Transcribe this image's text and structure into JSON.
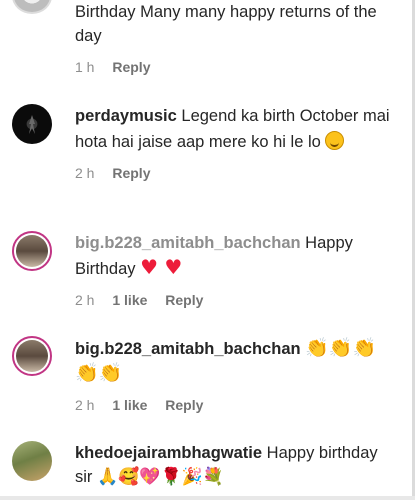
{
  "comments": [
    {
      "username": "",
      "text": "Birthday Many many happy returns of the day",
      "time": "1 h",
      "likes": "",
      "reply": "Reply",
      "avatar": "avatar-partial-icon"
    },
    {
      "username": "perdaymusic",
      "text": "Legend ka birth October mai hota hai jaise aap mere ko hi le lo",
      "emoji": "🙃",
      "time": "2 h",
      "likes": "",
      "reply": "Reply",
      "avatar": "dark-music-avatar-icon"
    },
    {
      "username": "big.b228_amitabh_bachchan",
      "text": "Happy Birthday",
      "emoji": "♥ ♥",
      "time": "2 h",
      "likes": "1 like",
      "reply": "Reply",
      "avatar": "portrait-avatar-icon"
    },
    {
      "username": "big.b228_amitabh_bachchan",
      "text": "",
      "emoji": "👏👏👏👏👏",
      "time": "2 h",
      "likes": "1 like",
      "reply": "Reply",
      "avatar": "portrait-avatar-icon"
    },
    {
      "username": "khedoejairambhagwatie",
      "text": "Happy birthday sir",
      "emoji": "🙏🥰💖🌹🎉💐",
      "time": "",
      "likes": "",
      "reply": "",
      "avatar": "outdoor-avatar-icon"
    }
  ],
  "colors": {
    "username": "#262626",
    "meta": "#8e8e8e",
    "heart": "#ed1c3a",
    "clap": "#f2b51b"
  }
}
